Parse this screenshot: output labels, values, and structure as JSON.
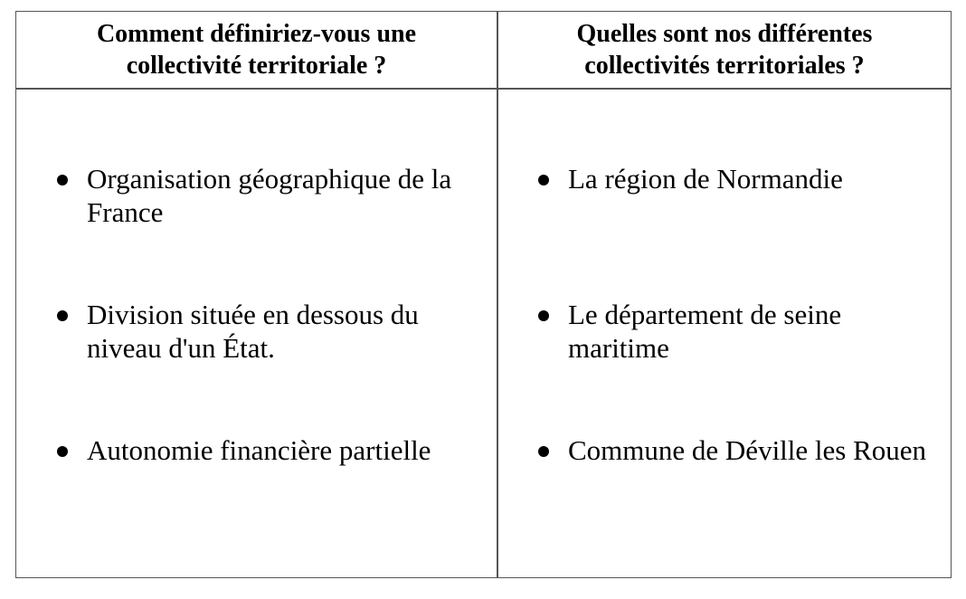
{
  "columns": [
    {
      "header": "Comment définiriez-vous une\ncollectivité territoriale ?",
      "items": [
        "Organisation géographique de la\nFrance",
        "Division située en dessous du\nniveau d'un État.",
        "Autonomie financière partielle"
      ]
    },
    {
      "header": "Quelles sont nos différentes\ncollectivités territoriales ?",
      "items": [
        "La région de Normandie",
        "Le département de seine\nmaritime",
        "Commune de Déville les Rouen"
      ]
    }
  ]
}
